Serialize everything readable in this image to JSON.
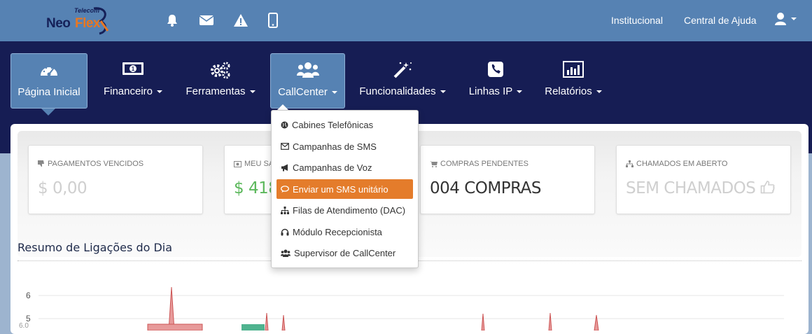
{
  "topbar": {
    "logo": {
      "tag": "Telecom",
      "neo": "Neo",
      "flex": "Flex"
    },
    "icons": [
      "bell-icon",
      "envelope-icon",
      "warning-icon",
      "mobile-icon"
    ],
    "links": [
      {
        "label": "Institucional"
      },
      {
        "label": "Central de Ajuda"
      }
    ],
    "user_icon": "user-icon"
  },
  "nav": {
    "items": [
      {
        "label": "Página Inicial",
        "icon": "dashboard-icon",
        "active": true
      },
      {
        "label": "Financeiro",
        "icon": "money-icon"
      },
      {
        "label": "Ferramentas",
        "icon": "gears-icon"
      },
      {
        "label": "CallCenter",
        "icon": "users-icon",
        "open": true
      },
      {
        "label": "Funcionalidades",
        "icon": "magic-wand-icon"
      },
      {
        "label": "Linhas IP",
        "icon": "phone-icon"
      },
      {
        "label": "Relatórios",
        "icon": "bar-chart-icon"
      }
    ]
  },
  "dropdown": {
    "items": [
      {
        "label": "Cabines Telefônicas",
        "icon": "globe-icon"
      },
      {
        "label": "Campanhas de SMS",
        "icon": "envelope-o-icon"
      },
      {
        "label": "Campanhas de Voz",
        "icon": "bullhorn-icon"
      },
      {
        "label": "Enviar um SMS unitário",
        "icon": "comments-icon",
        "highlighted": true
      },
      {
        "label": "Filas de Atendimento (DAC)",
        "icon": "sitemap-icon"
      },
      {
        "label": "Módulo Recepcionista",
        "icon": "headphones-icon"
      },
      {
        "label": "Supervisor de CallCenter",
        "icon": "users-icon"
      }
    ]
  },
  "cards": [
    {
      "title": "PAGAMENTOS VENCIDOS",
      "value": "$ 0,00",
      "icon": "thumbs-down-icon",
      "color": "#cfcfcf"
    },
    {
      "title": "MEU SA",
      "value": "$ 418,",
      "icon": "money-icon",
      "color": "#5cb85c"
    },
    {
      "title": "COMPRAS PENDENTES",
      "value": "004 COMPRAS",
      "icon": "cart-icon",
      "color": "#333333"
    },
    {
      "title": "CHAMADOS EM ABERTO",
      "value": "SEM CHAMADOS",
      "icon": "sitemap-icon",
      "color": "#cfcfcf"
    }
  ],
  "section": {
    "title": "Resumo de Ligações do Dia"
  },
  "chart": {
    "y_ticks": [
      "6",
      "5"
    ],
    "partial_tick": "6.0"
  },
  "colors": {
    "topbar": "#5682b3",
    "nav": "#161d54",
    "accent": "#e47c2b"
  }
}
